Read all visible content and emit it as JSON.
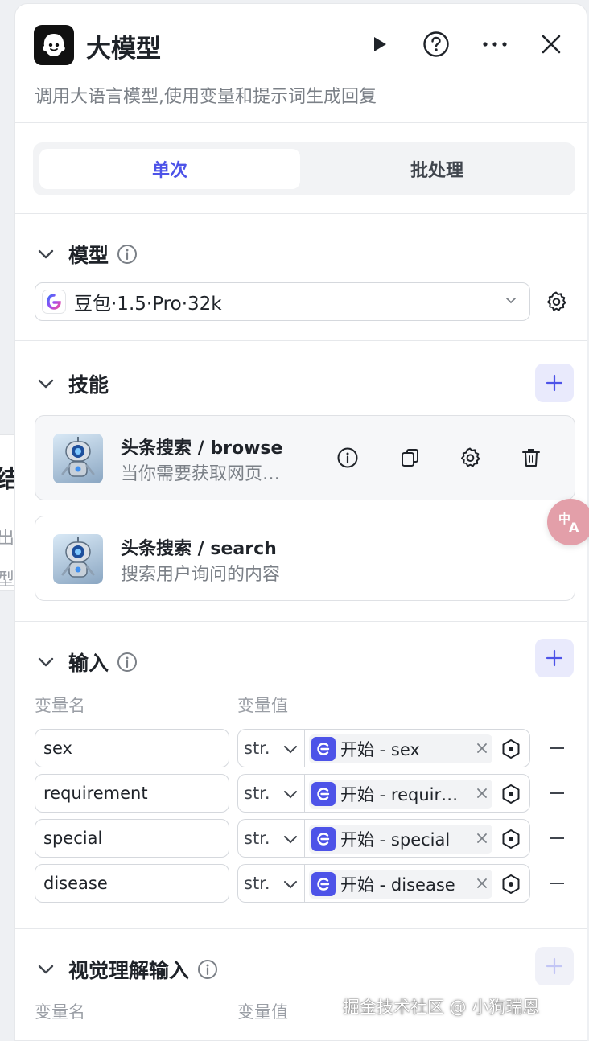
{
  "node": {
    "title": "大模型",
    "description": "调用大语言模型,使用变量和提示词生成回复"
  },
  "backdrop": {
    "title_fragment": "结",
    "line1_fragment": "出",
    "line2_fragment": "型"
  },
  "tabs": [
    {
      "label": "单次",
      "active": true
    },
    {
      "label": "批处理",
      "active": false
    }
  ],
  "model_section": {
    "title": "模型",
    "selected_model": "豆包·1.5·Pro·32k"
  },
  "skills_section": {
    "title": "技能",
    "items": [
      {
        "name": "头条搜索 / browse",
        "description": "当你需要获取网页…"
      },
      {
        "name": "头条搜索 / search",
        "description": "搜索用户询问的内容"
      }
    ]
  },
  "input_section": {
    "title": "输入",
    "col_name": "变量名",
    "col_value": "变量值",
    "rows": [
      {
        "name": "sex",
        "type": "str.",
        "ref": "开始 - sex"
      },
      {
        "name": "requirement",
        "type": "str.",
        "ref": "开始 - requir…"
      },
      {
        "name": "special",
        "type": "str.",
        "ref": "开始 - special"
      },
      {
        "name": "disease",
        "type": "str.",
        "ref": "开始 - disease"
      }
    ]
  },
  "vision_section": {
    "title": "视觉理解输入",
    "col_name": "变量名",
    "col_value": "变量值"
  },
  "watermark": "掘金技术社区 @ 小狗瑞恩",
  "colors": {
    "accent": "#4d53e8",
    "accent_bg": "#e9eafc",
    "muted_text": "#7b8087",
    "border": "#d5d8dd"
  }
}
